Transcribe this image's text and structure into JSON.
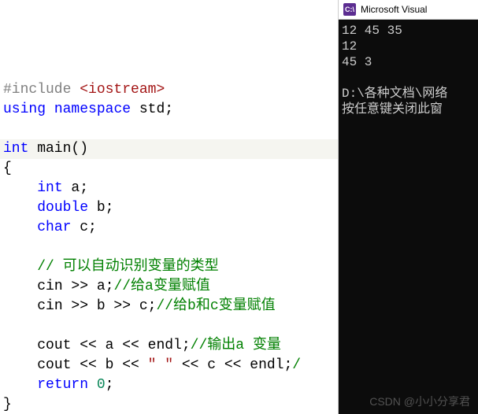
{
  "editor": {
    "lines": {
      "l1_pp": "#include",
      "l1_hdr": " <iostream>",
      "l2_kw1": "using",
      "l2_sp1": " ",
      "l2_kw2": "namespace",
      "l2_rest": " std;",
      "l4_kw": "int",
      "l4_rest": " main()",
      "l5": "{",
      "l6_indent": "    ",
      "l6_kw": "int",
      "l6_rest": " a;",
      "l7_indent": "    ",
      "l7_kw": "double",
      "l7_rest": " b;",
      "l8_indent": "    ",
      "l8_kw": "char",
      "l8_rest": " c;",
      "l10_indent": "    ",
      "l10_comment": "// 可以自动识别变量的类型",
      "l11_indent": "    ",
      "l11_code": "cin >> a;",
      "l11_comment": "//给a变量赋值",
      "l12_indent": "    ",
      "l12_code": "cin >> b >> c;",
      "l12_comment": "//给b和c变量赋值",
      "l14_indent": "    ",
      "l14_code": "cout << a << endl;",
      "l14_comment": "//输出a 变量",
      "l15_indent": "    ",
      "l15_code_a": "cout << b << ",
      "l15_str": "\" \"",
      "l15_code_b": " << c << endl;",
      "l15_comment": "/",
      "l16_indent": "    ",
      "l16_kw": "return",
      "l16_sp": " ",
      "l16_num": "0",
      "l16_semi": ";",
      "l17": "}"
    }
  },
  "console_window": {
    "title": "Microsoft Visual",
    "icon_text": "C:\\",
    "output": {
      "line1": "12 45 35",
      "line2": "12",
      "line3": "45 3",
      "blank": "",
      "line4": "D:\\各种文档\\网络",
      "line5": "按任意键关闭此窗"
    }
  },
  "watermark": "CSDN @小小分享君"
}
